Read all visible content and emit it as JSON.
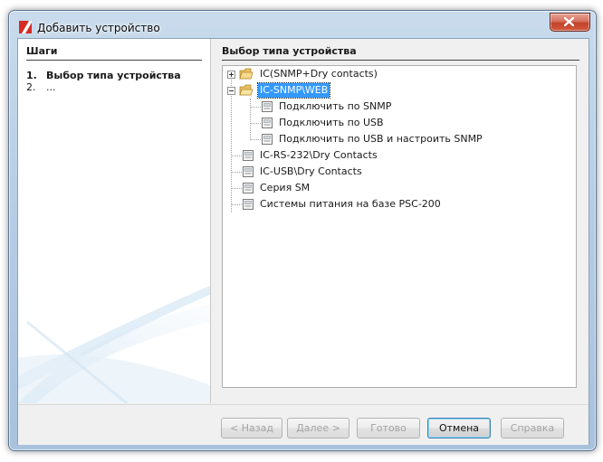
{
  "window": {
    "title": "Добавить устройство",
    "close_icon": "close-icon"
  },
  "steps": {
    "title": "Шаги",
    "items": [
      {
        "num": "1.",
        "label": "Выбор типа устройства"
      },
      {
        "num": "2.",
        "label": "..."
      }
    ]
  },
  "content": {
    "title": "Выбор типа устройства",
    "tree": [
      {
        "label": "IC(SNMP+Dry contacts)",
        "icon": "folder-icon",
        "expander": "plus"
      },
      {
        "label": "IC-SNMP\\WEB",
        "icon": "folder-icon",
        "expander": "minus",
        "selected": true
      },
      {
        "label": "Подключить по SNMP",
        "icon": "device-icon"
      },
      {
        "label": "Подключить по USB",
        "icon": "device-icon"
      },
      {
        "label": "Подключить по USB и настроить SNMP",
        "icon": "device-icon"
      },
      {
        "label": "IC-RS-232\\Dry Contacts",
        "icon": "device-icon"
      },
      {
        "label": "IC-USB\\Dry Contacts",
        "icon": "device-icon"
      },
      {
        "label": "Серия SM",
        "icon": "device-icon"
      },
      {
        "label": "Системы питания на базе PSC-200",
        "icon": "device-icon"
      }
    ]
  },
  "buttons": {
    "back": "< Назад",
    "next": "Далее >",
    "finish": "Готово",
    "cancel": "Отмена",
    "help": "Справка"
  },
  "colors": {
    "selection": "#3399ff",
    "brand_red": "#d62b25"
  }
}
